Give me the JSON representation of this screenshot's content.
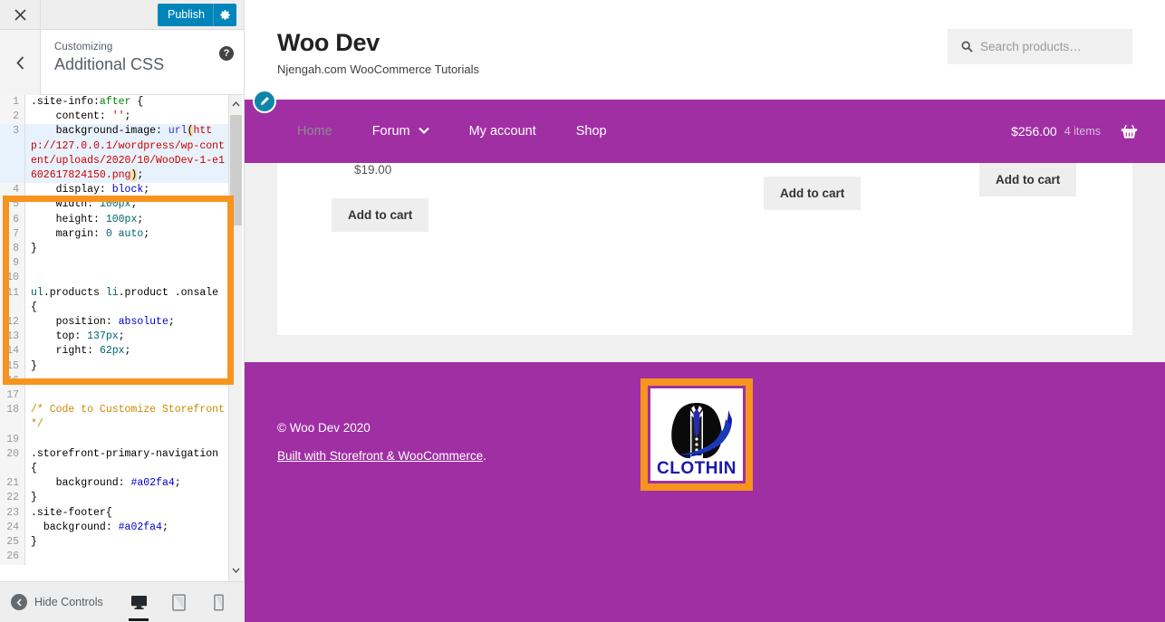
{
  "customizer": {
    "close_icon": "close-icon",
    "publish_label": "Publish",
    "gear_icon": "gear-icon",
    "back_icon": "chevron-left-icon",
    "eyebrow": "Customizing",
    "title": "Additional CSS",
    "help_icon": "help-icon",
    "hide_controls_label": "Hide Controls",
    "devices": [
      {
        "name": "desktop",
        "icon": "desktop-icon",
        "active": true
      },
      {
        "name": "tablet",
        "icon": "tablet-icon",
        "active": false
      },
      {
        "name": "mobile",
        "icon": "mobile-icon",
        "active": false
      }
    ],
    "scrollbar": {
      "up": "chevron-up-icon",
      "down": "chevron-down-icon"
    },
    "code_lines": [
      {
        "n": "1",
        "text": ".site-info:after {"
      },
      {
        "n": "2",
        "text": "    content: '';"
      },
      {
        "n": "3",
        "text": "    background-image: url(http://127.0.0.1/wordpress/wp-content/uploads/2020/10/WooDev-1-e1602617824150.png);",
        "active": true
      },
      {
        "n": "4",
        "text": "    display: block;"
      },
      {
        "n": "5",
        "text": "    width: 100px;"
      },
      {
        "n": "6",
        "text": "    height: 100px;"
      },
      {
        "n": "7",
        "text": "    margin: 0 auto;"
      },
      {
        "n": "8",
        "text": "}"
      },
      {
        "n": "9",
        "text": ""
      },
      {
        "n": "10",
        "text": ""
      },
      {
        "n": "11",
        "text": "ul.products li.product .onsale {"
      },
      {
        "n": "12",
        "text": "    position: absolute;"
      },
      {
        "n": "13",
        "text": "    top: 137px;"
      },
      {
        "n": "14",
        "text": "    right: 62px;"
      },
      {
        "n": "15",
        "text": "}"
      },
      {
        "n": "16",
        "text": ""
      },
      {
        "n": "17",
        "text": ""
      },
      {
        "n": "18",
        "text": "/* Code to Customize Storefront*/"
      },
      {
        "n": "19",
        "text": ""
      },
      {
        "n": "20",
        "text": ".storefront-primary-navigation {"
      },
      {
        "n": "21",
        "text": "    background: #a02fa4;"
      },
      {
        "n": "22",
        "text": "}"
      },
      {
        "n": "23",
        "text": ".site-footer{"
      },
      {
        "n": "24",
        "text": "  background: #a02fa4;"
      },
      {
        "n": "25",
        "text": "}"
      },
      {
        "n": "26",
        "text": ""
      }
    ]
  },
  "preview": {
    "site_title": "Woo Dev",
    "site_description": "Njengah.com WooCommerce Tutorials",
    "search": {
      "icon": "search-icon",
      "placeholder": "Search products…"
    },
    "edit_shortcut_icon": "pencil-icon",
    "nav": {
      "items": [
        {
          "label": "Home",
          "dim": true,
          "caret": false
        },
        {
          "label": "Forum",
          "dim": false,
          "caret": true
        },
        {
          "label": "My account",
          "dim": false,
          "caret": false
        },
        {
          "label": "Shop",
          "dim": false,
          "caret": false
        }
      ],
      "cart": {
        "amount": "$256.00",
        "items": "4 items",
        "icon": "basket-icon"
      }
    },
    "products": {
      "price_clipped": "$19.00",
      "add_to_cart_label": "Add to cart",
      "buttons": [
        "Add to cart",
        "Add to cart",
        "Add to cart"
      ]
    },
    "footer": {
      "copyright": "© Woo Dev 2020",
      "built_with_link": "Built with Storefront & WooCommerce",
      "built_with_period": ".",
      "logo_text": "CLOTHIN",
      "logo_name": "clothing-logo"
    }
  },
  "colors": {
    "publish_blue": "#0085ba",
    "highlight_orange": "#f7941e",
    "brand_purple": "#a02fa4",
    "logo_blue": "#1a1aa8",
    "edit_pencil_teal": "#0e86a8"
  }
}
